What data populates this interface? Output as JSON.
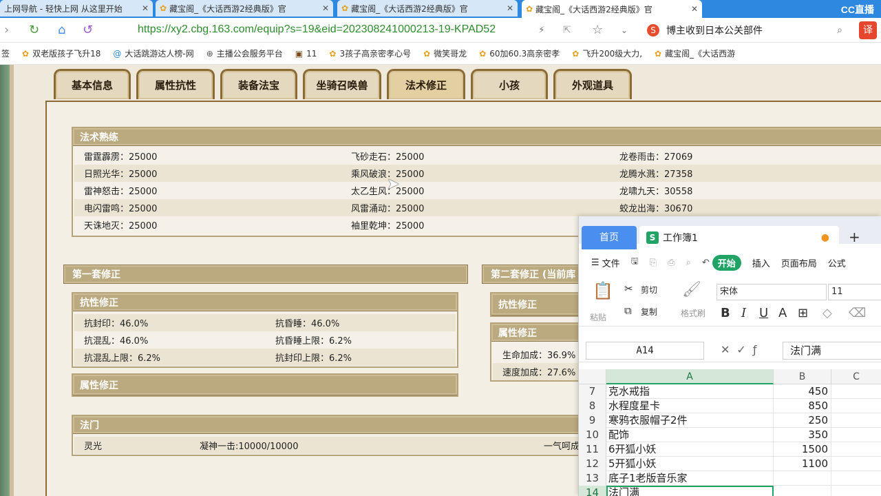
{
  "browser": {
    "tabs": [
      {
        "label": "上网导航 - 轻快上网 从这里开始",
        "active": false
      },
      {
        "label": "藏宝阁_《大话西游2经典版》官",
        "active": false
      },
      {
        "label": "藏宝阁_《大话西游2经典版》官",
        "active": false
      },
      {
        "label": "藏宝阁_《大话西游2经典版》官",
        "active": true
      }
    ],
    "brand": "CC直播",
    "url_prefix": "https://",
    "url_host": "xy2.cbg.163.com",
    "url_path": "/equip?s=19&eid=202308241000213-19-KPAD52",
    "search_text": "博主收到日本公关部件",
    "ext_label": "译",
    "bookmarks": [
      {
        "label": "签",
        "icon": ""
      },
      {
        "label": "双老版孩子飞升18",
        "icon": "game-icon"
      },
      {
        "label": "大话跳游达人榜-网",
        "icon": "swirl-icon"
      },
      {
        "label": "主播公会服务平台",
        "icon": "globe-icon"
      },
      {
        "label": "11",
        "icon": "image-icon"
      },
      {
        "label": "3孩子高亲密孝心号",
        "icon": "game-icon"
      },
      {
        "label": "微笑哥龙",
        "icon": "game-icon"
      },
      {
        "label": "60加60.3高亲密孝",
        "icon": "game-icon"
      },
      {
        "label": "飞升200级大力,",
        "icon": "game-icon"
      },
      {
        "label": "藏宝阁_《大话西游",
        "icon": "game-icon"
      }
    ]
  },
  "game": {
    "tabs": [
      "基本信息",
      "属性抗性",
      "装备法宝",
      "坐骑召唤兽",
      "法术修正",
      "小孩",
      "外观道具"
    ],
    "active_tab": 4,
    "spell_mastery": {
      "title": "法术熟练",
      "rows": [
        [
          "雷霆霹雳：25000",
          "飞砂走石：25000",
          "龙卷雨击：27069"
        ],
        [
          "日照光华：25000",
          "乘风破浪：25000",
          "龙腾水溅：27358"
        ],
        [
          "雷神怒击：25000",
          "太乙生风：25000",
          "龙啸九天：30558"
        ],
        [
          "电闪雷鸣：25000",
          "风雷涌动：25000",
          "蛟龙出海：30670"
        ],
        [
          "天诛地灭：25000",
          "袖里乾坤：25000",
          ""
        ]
      ]
    },
    "set1": {
      "title": "第一套修正",
      "resist_title": "抗性修正",
      "resist_rows": [
        [
          "抗封印：46.0%",
          "抗昏睡：46.0%"
        ],
        [
          "抗混乱：46.0%",
          "抗昏睡上限：6.2%"
        ],
        [
          "抗混乱上限：6.2%",
          "抗封印上限：6.2%"
        ]
      ],
      "attr_title": "属性修正"
    },
    "set2": {
      "title": "第二套修正 (当前库",
      "resist_title": "抗性修正",
      "attr_title": "属性修正",
      "attr_rows": [
        "生命加成：36.9%",
        "速度加成：27.6%"
      ]
    },
    "famen": {
      "title": "法门",
      "items": [
        "灵光",
        "凝神一击:10000/10000",
        "一气呵成"
      ]
    }
  },
  "spreadsheet": {
    "home_tab": "首页",
    "doc_icon": "S",
    "doc_title": "工作簿1",
    "menu": [
      "文件",
      "开始",
      "插入",
      "页面布局",
      "公式"
    ],
    "toolbar": {
      "cut": "剪切",
      "paste": "粘贴",
      "copy": "复制",
      "format_painter": "格式刷",
      "font_name": "宋体",
      "font_size": "11"
    },
    "name_box": "A14",
    "formula": "法门满",
    "columns": [
      "A",
      "B",
      "C"
    ],
    "rows": [
      {
        "num": "7",
        "a": "克水戒指",
        "b": "450"
      },
      {
        "num": "8",
        "a": "水程度星卡",
        "b": "850"
      },
      {
        "num": "9",
        "a": "寒鸦衣服帽子2件",
        "b": "250"
      },
      {
        "num": "10",
        "a": "配饰",
        "b": "350"
      },
      {
        "num": "11",
        "a": "6开狐小妖",
        "b": "1500"
      },
      {
        "num": "12",
        "a": "5开狐小妖",
        "b": "1100"
      },
      {
        "num": "13",
        "a": "底子1老版音乐家",
        "b": ""
      },
      {
        "num": "14",
        "a": "法门满",
        "b": ""
      }
    ],
    "active_row": "14"
  }
}
